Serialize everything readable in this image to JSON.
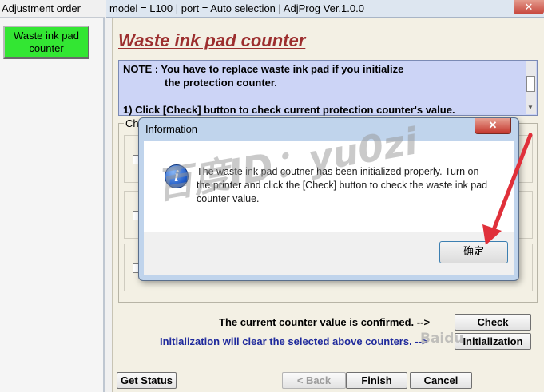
{
  "left_panel": {
    "title": "Adjustment order",
    "item_label": "Waste ink pad counter",
    "item_color": "#33e633"
  },
  "main_window": {
    "title": "model = L100 | port = Auto selection | AdjProg Ver.1.0.0",
    "close_icon": "x-icon",
    "heading": "Waste ink pad counter",
    "note": {
      "line1": "NOTE : You have to replace waste ink pad if you initialize",
      "line2": "the protection counter.",
      "line3": "1) Click [Check] button to check current protection counter's value."
    },
    "counter_group_label": "Ch",
    "confirmed_text": "The current counter value is confirmed. -->",
    "init_text": "Initialization will clear the selected above counters. -->",
    "check_label": "Check",
    "initialization_label": "Initialization",
    "get_status_label": "Get Status",
    "back_label": "< Back",
    "finish_label": "Finish",
    "cancel_label": "Cancel"
  },
  "dialog": {
    "title": "Information",
    "close_icon": "x-icon",
    "icon": "info-icon",
    "message": "The waste ink pad coutner has been initialized properly. Turn on the printer and click the [Check] button to check the waste ink pad counter value.",
    "ok_label": "确定"
  },
  "overlays": {
    "watermark": "百度ID：yu0zi",
    "baidu_mark": "Baidu",
    "arrow_color": "#e0303a"
  }
}
